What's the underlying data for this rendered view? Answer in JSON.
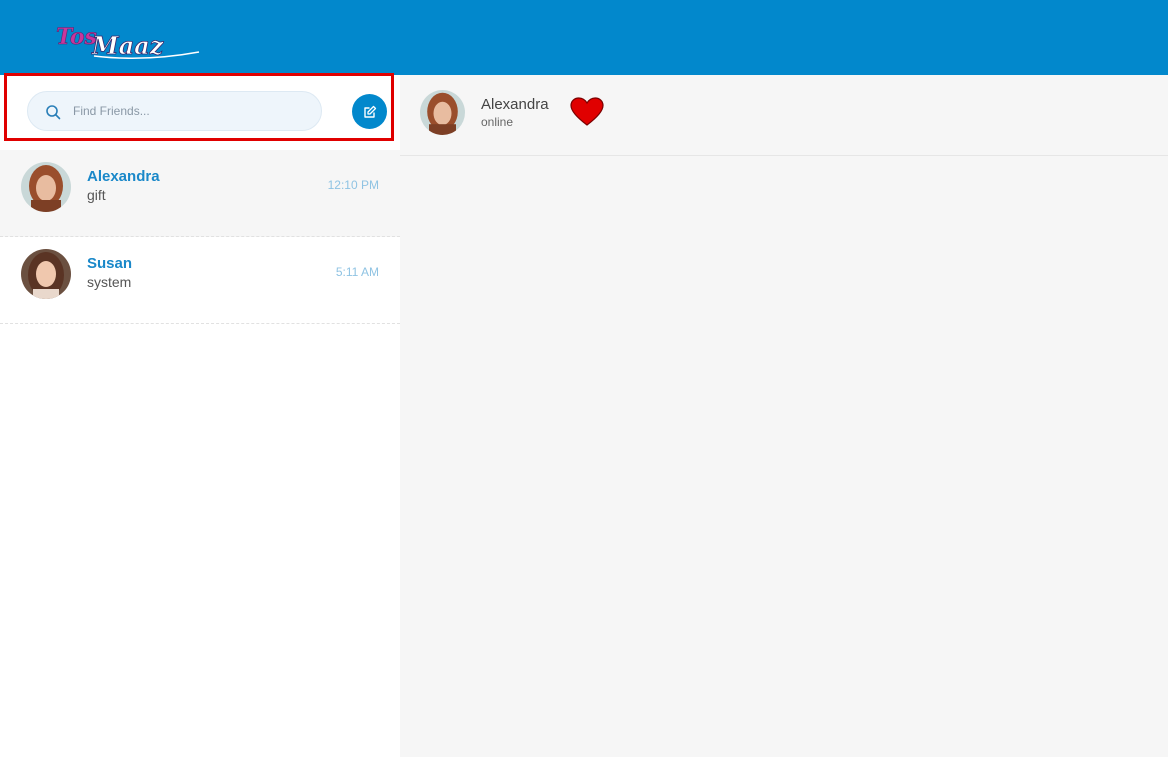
{
  "app": {
    "logo_text_1": "Tos",
    "logo_text_2": "Maaz"
  },
  "search": {
    "placeholder": "Find Friends...",
    "value": ""
  },
  "conversations": [
    {
      "name": "Alexandra",
      "last_message": "gift",
      "time": "12:10 PM",
      "active": true
    },
    {
      "name": "Susan",
      "last_message": "system",
      "time": "5:11 AM",
      "active": false
    }
  ],
  "chat": {
    "contact_name": "Alexandra",
    "status": "online"
  },
  "icons": {
    "search": "search-icon",
    "compose": "edit-icon",
    "like": "heart-icon"
  },
  "colors": {
    "brand": "#0288cc",
    "highlight_border": "#e00000",
    "heart": "#e00000",
    "name_link": "#1a88c9"
  }
}
